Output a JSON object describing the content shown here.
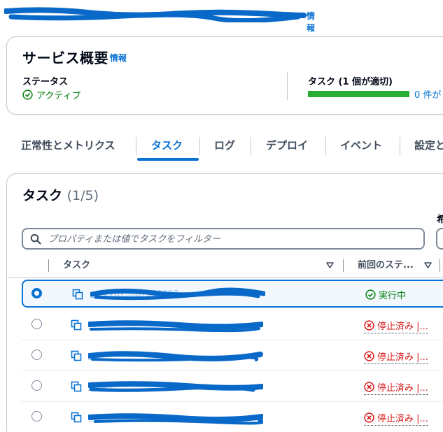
{
  "header": {
    "info_label": "情報"
  },
  "summary": {
    "title": "サービス概要",
    "info_label": "情報",
    "status_label": "ステータス",
    "status_value": "アクティブ",
    "tasks_label": "タスク (1 個が適切)",
    "tasks_progress_fraction": 1.0,
    "tasks_progress_text": "0 件が",
    "colors": {
      "active": "#037f0c",
      "progress": "#29ad32",
      "link": "#0972d3"
    }
  },
  "tabs": [
    {
      "label": "正常性とメトリクス"
    },
    {
      "label": "タスク"
    },
    {
      "label": "ログ"
    },
    {
      "label": "デプロイ"
    },
    {
      "label": "イベント"
    },
    {
      "label": "設定と"
    }
  ],
  "active_tab": "タスク",
  "tasks": {
    "title": "タスク",
    "count": "(1/5)",
    "right_label": "希",
    "search_placeholder": "プロパティまたは値でタスクをフィルター",
    "columns": [
      {
        "label": "タスク"
      },
      {
        "label": "前回のステ..."
      }
    ],
    "rows": [
      {
        "id": "...227d73887352397",
        "status": "実行中",
        "selected": true,
        "icon": "check-circle-icon"
      },
      {
        "id": "...",
        "status": "停止済み |...",
        "selected": false,
        "icon": "x-circle-icon"
      },
      {
        "id": "...",
        "status": "停止済み |...",
        "selected": false,
        "icon": "x-circle-icon"
      },
      {
        "id": "...346",
        "status": "停止済み |...",
        "selected": false,
        "icon": "x-circle-icon"
      },
      {
        "id": "...",
        "status": "停止済み |...",
        "selected": false,
        "icon": "x-circle-icon"
      }
    ]
  }
}
